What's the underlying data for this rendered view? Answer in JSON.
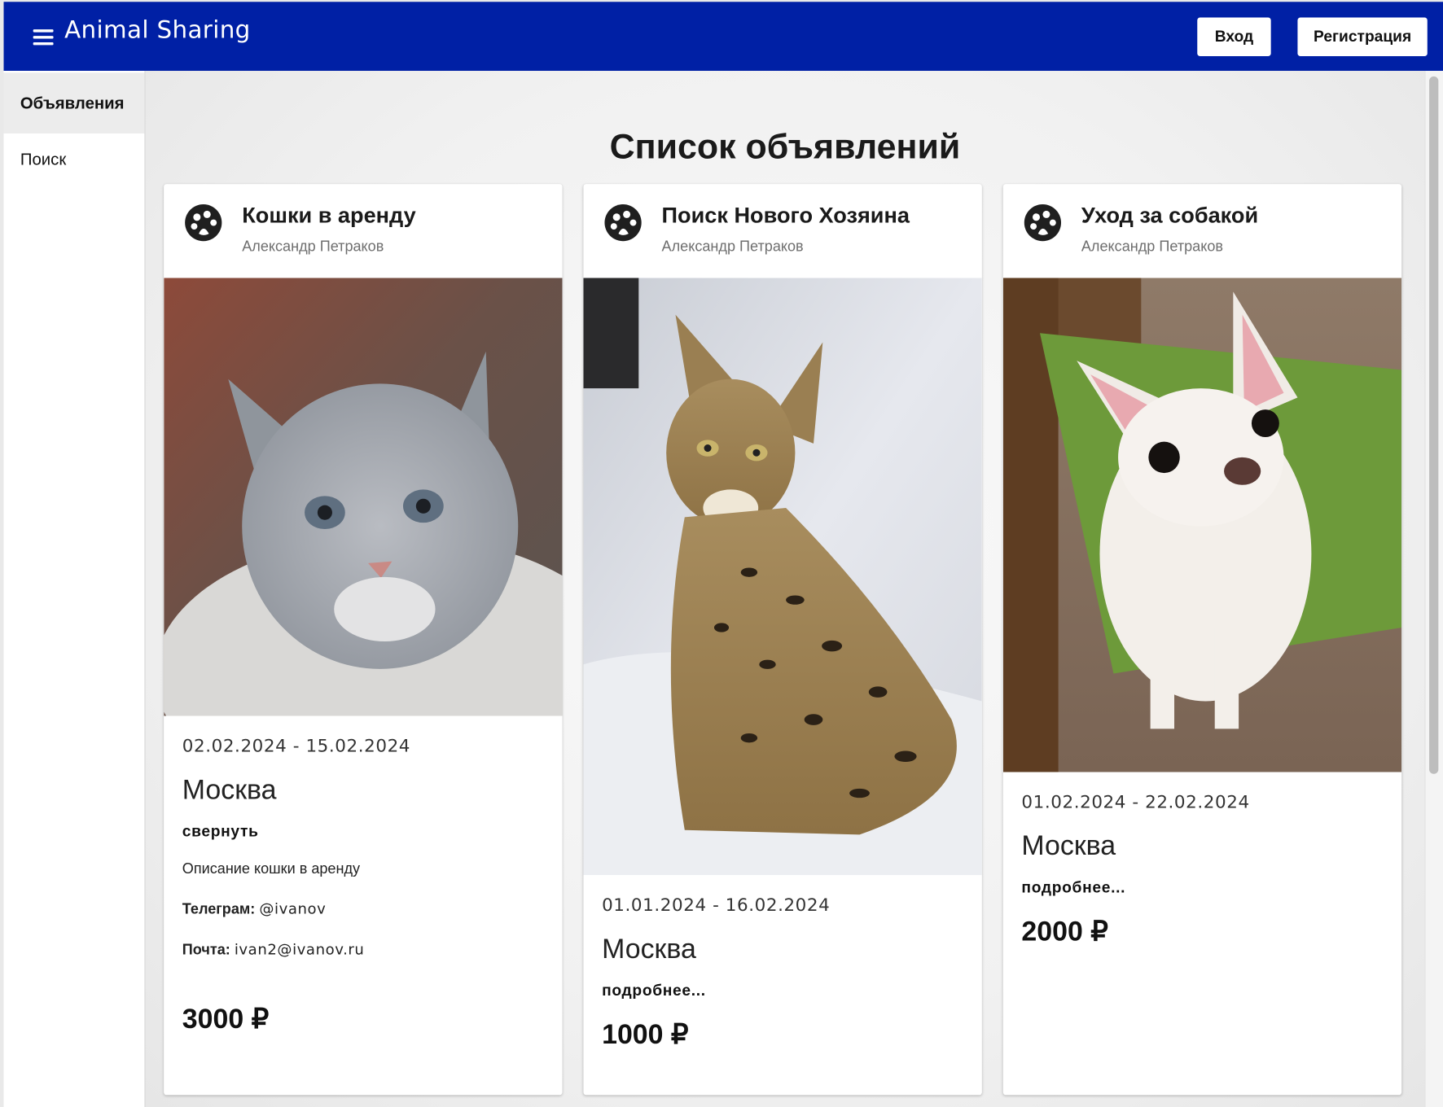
{
  "appbar": {
    "title": "Animal Sharing",
    "login_label": "Вход",
    "register_label": "Регистрация"
  },
  "sidebar": {
    "items": [
      {
        "label": "Объявления",
        "active": true
      },
      {
        "label": "Поиск",
        "active": false
      }
    ]
  },
  "main": {
    "title": "Список объявлений"
  },
  "cards": [
    {
      "title": "Кошки в аренду",
      "author": "Александр Петраков",
      "image": "grey-cat-photo",
      "dates": "02.02.2024 - 15.02.2024",
      "city": "Москва",
      "toggle_label": "свернуть",
      "description": "Описание кошки в аренду",
      "telegram_label": "Телеграм:",
      "telegram_value": "@ivanov",
      "email_label": "Почта:",
      "email_value": "ivan2@ivanov.ru",
      "price": "3000 ₽"
    },
    {
      "title": "Поиск Нового Хозяина",
      "author": "Александр Петраков",
      "image": "serval-cat-photo",
      "dates": "01.01.2024 - 16.02.2024",
      "city": "Москва",
      "toggle_label": "подробнее...",
      "price": "1000 ₽"
    },
    {
      "title": "Уход за собакой",
      "author": "Александр Петраков",
      "image": "chihuahua-photo",
      "dates": "01.02.2024 - 22.02.2024",
      "city": "Москва",
      "toggle_label": "подробнее...",
      "price": "2000 ₽"
    }
  ],
  "icons": {
    "menu": "menu-icon",
    "avatar": "pets-icon"
  },
  "colors": {
    "appbar": "#0020a5",
    "background": "#f1f1f1"
  }
}
